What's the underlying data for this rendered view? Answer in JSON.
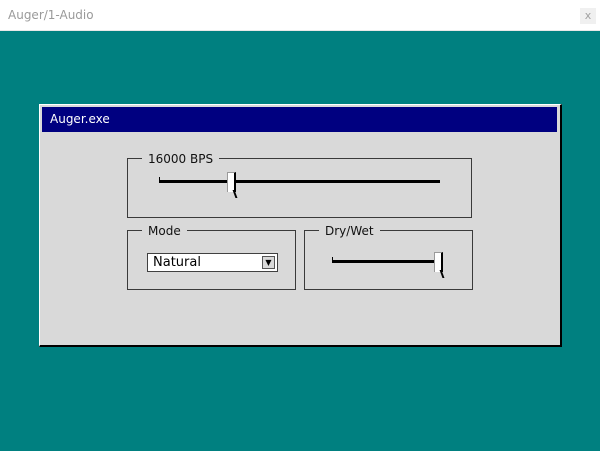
{
  "host": {
    "title": "Auger/1-Audio",
    "close_glyph": "x"
  },
  "plugin": {
    "title": "Auger.exe",
    "bps_group": {
      "label": "16000 BPS",
      "slider_fraction": 0.25
    },
    "mode_group": {
      "label": "Mode",
      "selected": "Natural",
      "arrow_icon": "chevron-down-icon"
    },
    "drywet_group": {
      "label": "Dry/Wet",
      "slider_fraction": 1.0
    }
  },
  "colors": {
    "desktop": "#008080",
    "titlebar": "#000080",
    "panel": "#d9d9d9"
  }
}
